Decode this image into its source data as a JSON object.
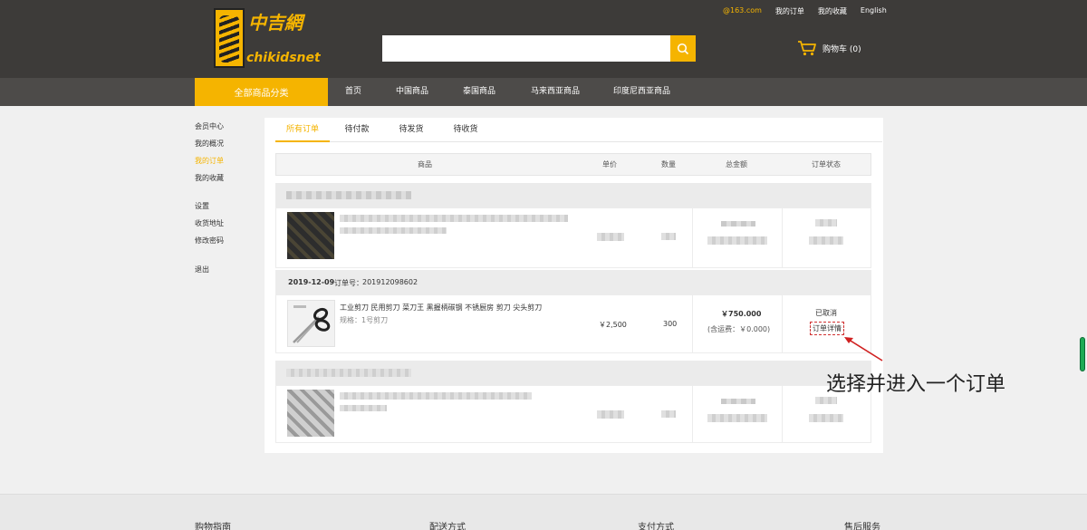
{
  "header": {
    "logo_cn": "中吉網",
    "logo_en": "chikidsnet",
    "search_placeholder": "",
    "account": "@163.com",
    "my_orders": "我的订单",
    "my_favorites": "我的收藏",
    "language": "English",
    "cart_label": "购物车 (0)"
  },
  "nav": {
    "all_categories": "全部商品分类",
    "items": [
      "首页",
      "中国商品",
      "泰国商品",
      "马来西亚商品",
      "印度尼西亚商品"
    ]
  },
  "sidebar": {
    "member_center": "会员中心",
    "overview": "我的概况",
    "orders": "我的订单",
    "favorites": "我的收藏",
    "settings": "设置",
    "address": "收货地址",
    "password": "修改密码",
    "logout": "退出"
  },
  "tabs": [
    "所有订单",
    "待付款",
    "待发货",
    "待收货"
  ],
  "table_headers": [
    "商品",
    "单价",
    "数量",
    "总金额",
    "订单状态"
  ],
  "order": {
    "date": "2019-12-09",
    "number_label": "订单号：",
    "number": "201912098602",
    "product_name": "工业剪刀 民用剪刀 菜刀王 黑握柄碳钢 不锈厨房 剪刀 尖头剪刀",
    "spec": "规格：1号剪刀",
    "unit_price": "￥2,500",
    "quantity": "300",
    "total": "￥750.000",
    "shipping": "(含运费：￥0.000)",
    "status": "已取消",
    "detail_link": "订单详情"
  },
  "annotation": "选择并进入一个订单",
  "footer": [
    "购物指南",
    "配送方式",
    "支付方式",
    "售后服务"
  ],
  "colors": {
    "accent": "#f5b400",
    "header_bg": "#3d3b39",
    "nav_bg": "#4d4b49",
    "annotation_arrow": "#d02020"
  }
}
